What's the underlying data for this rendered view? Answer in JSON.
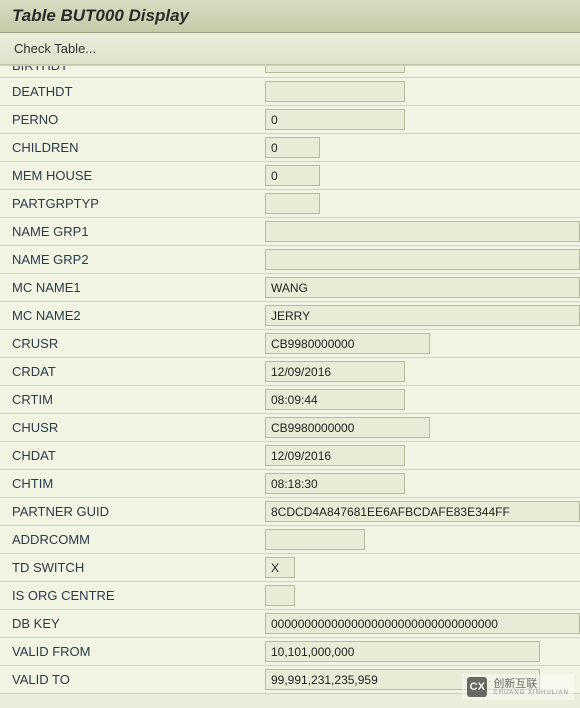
{
  "header": {
    "title": "Table BUT000 Display"
  },
  "toolbar": {
    "check_table": "Check Table..."
  },
  "fields": [
    {
      "label": "BIRTHDT",
      "value": "",
      "width": "w-md",
      "cutoff": true
    },
    {
      "label": "DEATHDT",
      "value": "",
      "width": "w-md"
    },
    {
      "label": "PERNO",
      "value": "0",
      "width": "w-md"
    },
    {
      "label": "CHILDREN",
      "value": "0",
      "width": "w-xs"
    },
    {
      "label": "MEM HOUSE",
      "value": "0",
      "width": "w-xs"
    },
    {
      "label": "PARTGRPTYP",
      "value": "",
      "width": "w-xs"
    },
    {
      "label": "NAME GRP1",
      "value": "",
      "width": "w-full"
    },
    {
      "label": "NAME GRP2",
      "value": "",
      "width": "w-full"
    },
    {
      "label": "MC NAME1",
      "value": "WANG",
      "width": "w-full"
    },
    {
      "label": "MC NAME2",
      "value": "JERRY",
      "width": "w-full"
    },
    {
      "label": "CRUSR",
      "value": "CB9980000000",
      "width": "w-lg"
    },
    {
      "label": "CRDAT",
      "value": "12/09/2016",
      "width": "w-md"
    },
    {
      "label": "CRTIM",
      "value": "08:09:44",
      "width": "w-md"
    },
    {
      "label": "CHUSR",
      "value": "CB9980000000",
      "width": "w-lg"
    },
    {
      "label": "CHDAT",
      "value": "12/09/2016",
      "width": "w-md"
    },
    {
      "label": "CHTIM",
      "value": "08:18:30",
      "width": "w-md"
    },
    {
      "label": "PARTNER GUID",
      "value": "8CDCD4A847681EE6AFBCDAFE83E344FF",
      "width": "w-full"
    },
    {
      "label": "ADDRCOMM",
      "value": "",
      "width": "w-sm"
    },
    {
      "label": "TD SWITCH",
      "value": "X",
      "width": "w-tiny"
    },
    {
      "label": "IS ORG CENTRE",
      "value": "",
      "width": "w-tiny"
    },
    {
      "label": "DB KEY",
      "value": "0000000000000000000000000000000000",
      "width": "w-full"
    },
    {
      "label": "VALID FROM",
      "value": "10,101,000,000",
      "width": "w-xl"
    },
    {
      "label": "VALID TO",
      "value": "99,991,231,235,959",
      "width": "w-xl"
    }
  ],
  "watermark": {
    "icon": "CX",
    "text": "创新互联",
    "sub": "CHUANG XINHULIAN"
  }
}
